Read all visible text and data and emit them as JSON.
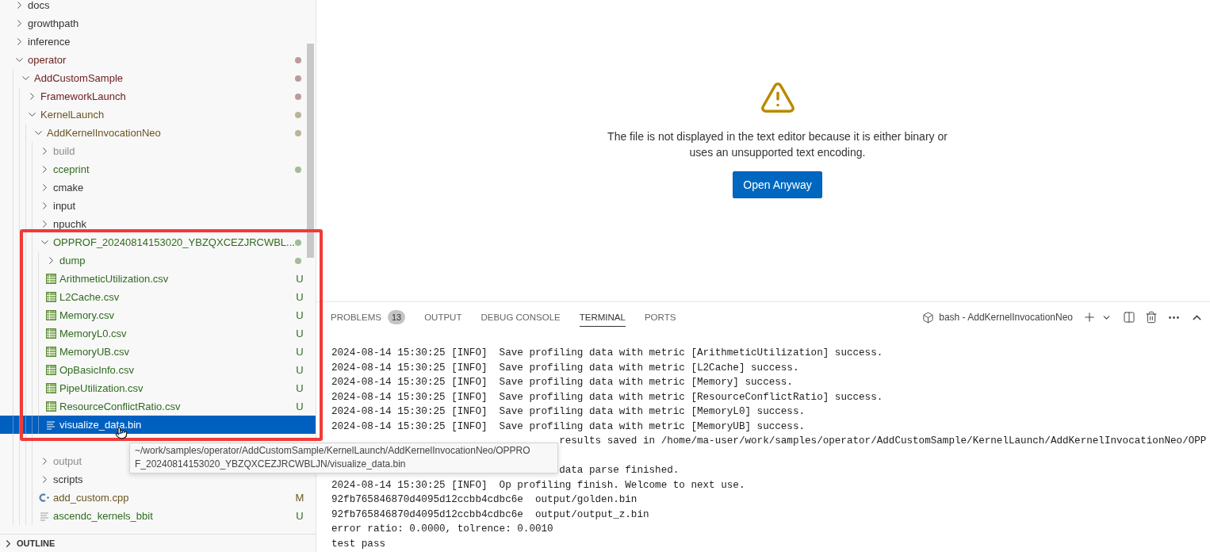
{
  "explorer": {
    "items": [
      {
        "kind": "folder",
        "name": "docs",
        "expanded": false
      },
      {
        "kind": "folder",
        "name": "growthpath",
        "expanded": false
      },
      {
        "kind": "folder",
        "name": "inference",
        "expanded": false
      },
      {
        "kind": "folder",
        "name": "operator",
        "expanded": true,
        "color": "#6e2020",
        "children": [
          {
            "kind": "folder",
            "name": "AddCustomSample",
            "expanded": true,
            "color": "#6e2020",
            "children": [
              {
                "kind": "folder",
                "name": "FrameworkLaunch",
                "expanded": false,
                "color": "#6e2020"
              },
              {
                "kind": "folder",
                "name": "KernelLaunch",
                "expanded": true,
                "color": "#6b5520",
                "children": [
                  {
                    "kind": "folder",
                    "name": "AddKernelInvocationNeo",
                    "expanded": true,
                    "color": "#6b5520",
                    "children": [
                      {
                        "kind": "folder",
                        "name": "build",
                        "expanded": false,
                        "ignored": true
                      },
                      {
                        "kind": "folder",
                        "name": "cceprint",
                        "expanded": false,
                        "color": "#2f6b1f"
                      },
                      {
                        "kind": "folder",
                        "name": "cmake",
                        "expanded": false
                      },
                      {
                        "kind": "folder",
                        "name": "input",
                        "expanded": false
                      },
                      {
                        "kind": "folder",
                        "name": "npuchk",
                        "expanded": false
                      },
                      {
                        "kind": "folder",
                        "name": "OPPROF_20240814153020_YBZQXCEZJRCWBL...",
                        "expanded": true,
                        "color": "#2f6b1f",
                        "children": [
                          {
                            "kind": "folder",
                            "name": "dump",
                            "expanded": false,
                            "color": "#2f6b1f"
                          },
                          {
                            "kind": "csv",
                            "name": "ArithmeticUtilization.csv",
                            "color": "#2f6b1f",
                            "badge": "U",
                            "selected": false
                          },
                          {
                            "kind": "csv",
                            "name": "L2Cache.csv",
                            "color": "#2f6b1f",
                            "badge": "U",
                            "selected": false
                          },
                          {
                            "kind": "csv",
                            "name": "Memory.csv",
                            "color": "#2f6b1f",
                            "badge": "U",
                            "selected": false
                          },
                          {
                            "kind": "csv",
                            "name": "MemoryL0.csv",
                            "color": "#2f6b1f",
                            "badge": "U",
                            "selected": false
                          },
                          {
                            "kind": "csv",
                            "name": "MemoryUB.csv",
                            "color": "#2f6b1f",
                            "badge": "U",
                            "selected": false
                          },
                          {
                            "kind": "csv",
                            "name": "OpBasicInfo.csv",
                            "color": "#2f6b1f",
                            "badge": "U",
                            "selected": false
                          },
                          {
                            "kind": "csv",
                            "name": "PipeUtilization.csv",
                            "color": "#2f6b1f",
                            "badge": "U",
                            "selected": false
                          },
                          {
                            "kind": "csv",
                            "name": "ResourceConflictRatio.csv",
                            "color": "#2f6b1f",
                            "badge": "U",
                            "selected": false
                          },
                          {
                            "kind": "text",
                            "name": "visualize_data.bin",
                            "selected": true
                          }
                        ]
                      },
                      {
                        "kind": "covered"
                      },
                      {
                        "kind": "folder",
                        "name": "output",
                        "expanded": false,
                        "ignored": true
                      },
                      {
                        "kind": "folder",
                        "name": "scripts",
                        "expanded": false
                      },
                      {
                        "kind": "cpp",
                        "name": "add_custom.cpp",
                        "color": "#6b5520",
                        "badge": "M",
                        "selected": false
                      },
                      {
                        "kind": "text",
                        "name": "ascendc_kernels_bbit",
                        "color": "#2f6b1f",
                        "badge": "U",
                        "selected": false
                      }
                    ]
                  }
                ]
              }
            ]
          }
        ]
      }
    ],
    "tooltip": {
      "lines": [
        "~/work/samples/operator/AddCustomSample/KernelLaunch/AddKernelInvocationNeo/OPPRO",
        "F_20240814153020_YBZQXCEZJRCWBLJN/visualize_data.bin"
      ]
    },
    "outline": {
      "title": "OUTLINE",
      "expanded": false
    }
  },
  "editor": {
    "message": "The file is not displayed in the text editor because it is either binary or uses an unsupported text encoding.",
    "button": "Open Anyway"
  },
  "panel": {
    "tabs": [
      {
        "label": "PROBLEMS",
        "count": "13",
        "selected": false
      },
      {
        "label": "OUTPUT",
        "selected": false
      },
      {
        "label": "DEBUG CONSOLE",
        "selected": false
      },
      {
        "label": "TERMINAL",
        "selected": true
      },
      {
        "label": "PORTS",
        "selected": false
      }
    ],
    "terminal_name": "bash - AddKernelInvocationNeo",
    "lines": [
      {
        "kind": "full",
        "text": "2024-08-14 15:30:25 [INFO]  Save profiling data with metric [ArithmeticUtilization] success."
      },
      {
        "kind": "full",
        "text": "2024-08-14 15:30:25 [INFO]  Save profiling data with metric [L2Cache] success."
      },
      {
        "kind": "full",
        "text": "2024-08-14 15:30:25 [INFO]  Save profiling data with metric [Memory] success."
      },
      {
        "kind": "full",
        "text": "2024-08-14 15:30:25 [INFO]  Save profiling data with metric [ResourceConflictRatio] success."
      },
      {
        "kind": "full",
        "text": "2024-08-14 15:30:25 [INFO]  Save profiling data with metric [MemoryL0] success."
      },
      {
        "kind": "full",
        "text": "2024-08-14 15:30:25 [INFO]  Save profiling data with metric [MemoryUB] success."
      },
      {
        "kind": "covered",
        "text": "results saved in /home/ma-user/work/samples/operator/AddCustomSample/KernelLaunch/AddKernelInvocationNeo/OPP"
      },
      {
        "kind": "blank"
      },
      {
        "kind": "covered",
        "text": "data parse finished."
      },
      {
        "kind": "full",
        "text": "2024-08-14 15:30:25 [INFO]  Op profiling finish. Welcome to next use."
      },
      {
        "kind": "full",
        "text": "92fb765846870d4095d12ccbb4cdbc6e  output/golden.bin"
      },
      {
        "kind": "full",
        "text": "92fb765846870d4095d12ccbb4cdbc6e  output/output_z.bin"
      },
      {
        "kind": "full",
        "text": "error ratio: 0.0000, tolrence: 0.0010"
      },
      {
        "kind": "full",
        "text": "test pass"
      }
    ]
  }
}
